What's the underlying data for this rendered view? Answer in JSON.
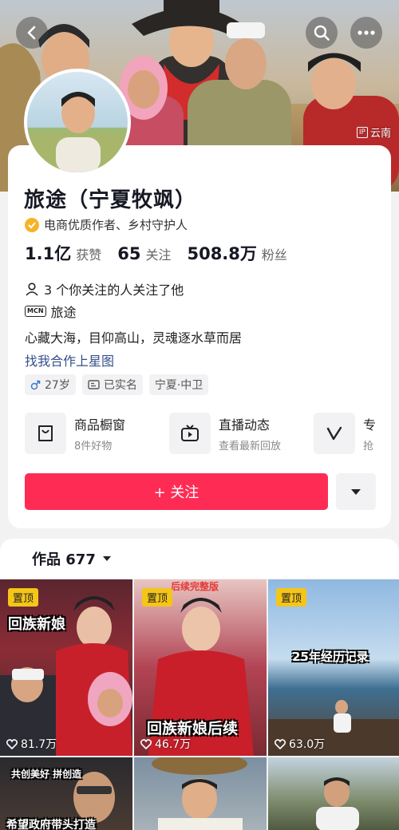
{
  "header": {
    "ip_location": "云南",
    "ip_label": "IP"
  },
  "profile": {
    "name": "旅途（宁夏牧飒）",
    "verification": "电商优质作者、乡村守护人",
    "stats": [
      {
        "value": "1.1亿",
        "label": "获赞"
      },
      {
        "value": "65",
        "label": "关注"
      },
      {
        "value": "508.8万",
        "label": "粉丝"
      }
    ],
    "mutual_follow": "3 个你关注的人关注了他",
    "mcn_badge": "MCN",
    "mcn_name": "旅途",
    "bio": "心藏大海，目仰高山，灵魂逐水草而居",
    "collab_link": "找我合作上星图",
    "tags": [
      {
        "icon": "male-icon",
        "text": "27岁"
      },
      {
        "icon": "id-card-icon",
        "text": "已实名"
      },
      {
        "icon": "",
        "text": "宁夏·中卫"
      }
    ]
  },
  "features": [
    {
      "icon": "shop-window-icon",
      "title": "商品橱窗",
      "subtitle": "8件好物"
    },
    {
      "icon": "live-tv-icon",
      "title": "直播动态",
      "subtitle": "查看最新回放"
    },
    {
      "icon": "v-icon",
      "title": "专",
      "subtitle": "抢"
    }
  ],
  "actions": {
    "follow_label": "+ 关注"
  },
  "works": {
    "title": "作品 677",
    "items": [
      {
        "pinned": "置顶",
        "overlay": "回族新娘",
        "likes": "81.7万"
      },
      {
        "pinned": "置顶",
        "overlay": "回族新娘后续",
        "top_text": "后续完整版",
        "likes": "46.7万"
      },
      {
        "pinned": "置顶",
        "overlay": "25年经历记录",
        "likes": "63.0万"
      },
      {
        "overlay": "希望政府带头打造",
        "top_text": "共创美好 拼创造"
      },
      {},
      {}
    ]
  },
  "colors": {
    "accent": "#fe2c55",
    "link": "#33508c",
    "pin": "#f5c518"
  }
}
